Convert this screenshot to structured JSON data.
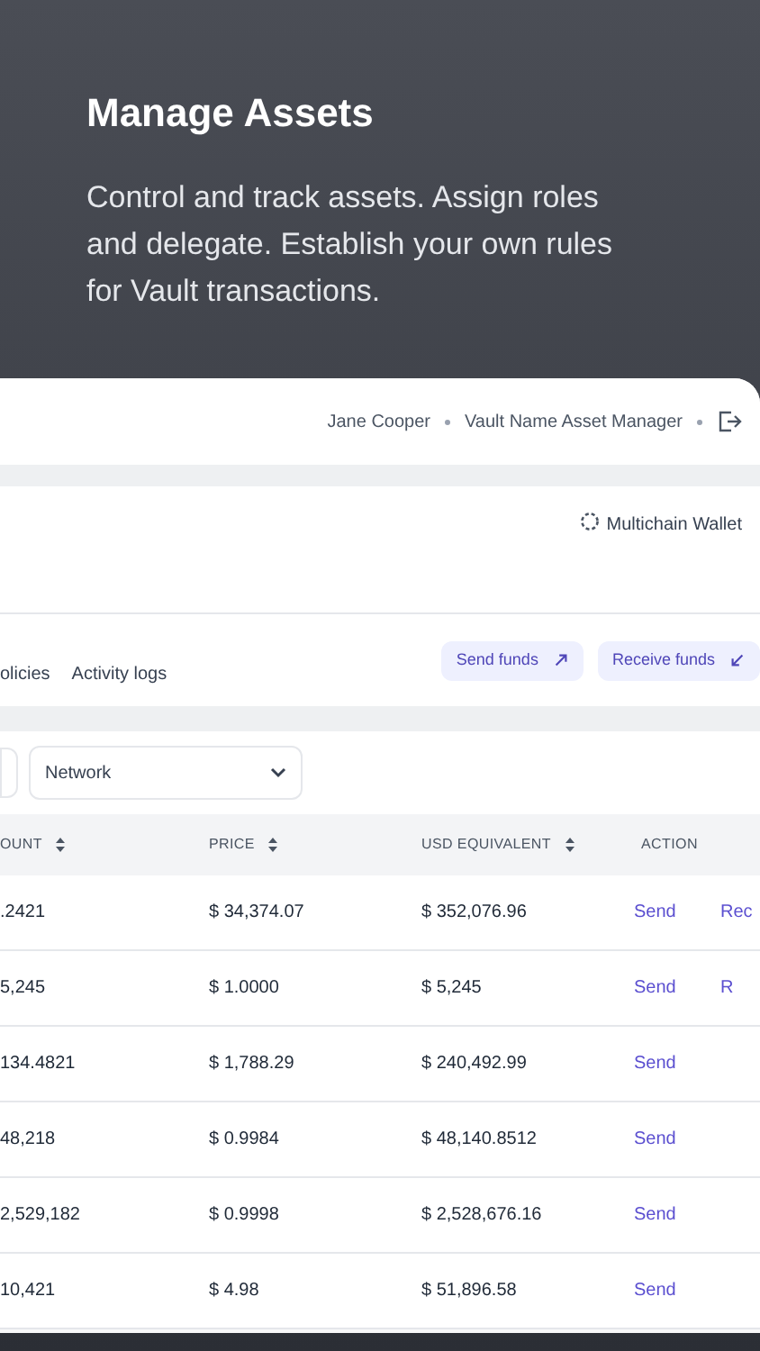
{
  "hero": {
    "title": "Manage Assets",
    "text": "Control and track assets. Assign roles and delegate. Establish your own rules for Vault transactions."
  },
  "top_bar": {
    "user": "Jane Cooper",
    "vault": "Vault Name Asset Manager"
  },
  "wallet": {
    "label": "Multichain Wallet"
  },
  "tabs": [
    {
      "label": "olicies"
    },
    {
      "label": "Activity logs"
    }
  ],
  "buttons": [
    {
      "label": "Send funds",
      "kind": "send"
    },
    {
      "label": "Receive funds",
      "kind": "receive"
    }
  ],
  "filters": {
    "network": "Network"
  },
  "table": {
    "columns": [
      {
        "label": "OUNT",
        "sortable": true
      },
      {
        "label": "PRICE",
        "sortable": true
      },
      {
        "label": "USD EQUIVALENT",
        "sortable": true
      },
      {
        "label": "ACTION",
        "sortable": false
      }
    ],
    "rows": [
      {
        "amount": ".2421",
        "price": "$ 34,374.07",
        "usd": "$ 352,076.96",
        "actions": [
          "Send",
          "Rec"
        ]
      },
      {
        "amount": "5,245",
        "price": "$ 1.0000",
        "usd": "$ 5,245",
        "actions": [
          "Send",
          "R"
        ]
      },
      {
        "amount": "134.4821",
        "price": "$ 1,788.29",
        "usd": "$ 240,492.99",
        "actions": [
          "Send"
        ]
      },
      {
        "amount": "48,218",
        "price": "$ 0.9984",
        "usd": "$ 48,140.8512",
        "actions": [
          "Send"
        ]
      },
      {
        "amount": "2,529,182",
        "price": "$ 0.9998",
        "usd": "$ 2,528,676.16",
        "actions": [
          "Send"
        ]
      },
      {
        "amount": "10,421",
        "price": "$ 4.98",
        "usd": "$ 51,896.58",
        "actions": [
          "Send"
        ]
      }
    ]
  }
}
